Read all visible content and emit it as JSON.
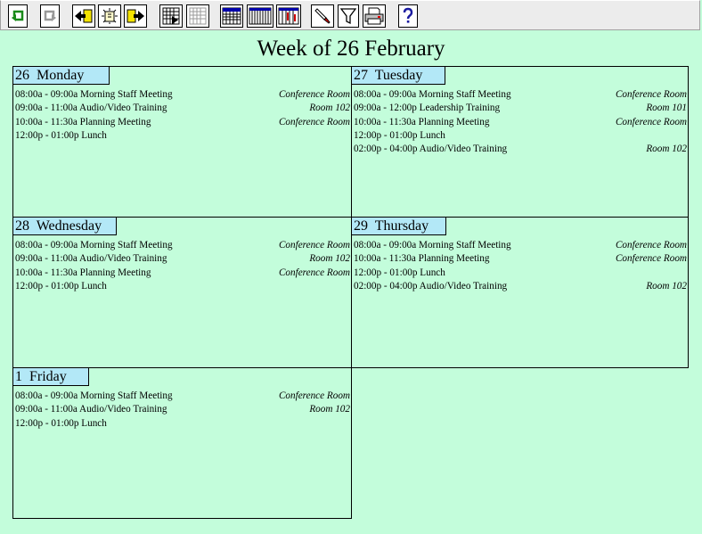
{
  "toolbar": {
    "buttons": [
      {
        "name": "undo-button",
        "icon": "undo-arrow-icon"
      },
      {
        "name": "redo-button",
        "icon": "redo-arrow-icon"
      },
      {
        "name": "previous-button",
        "icon": "arrow-left-icon"
      },
      {
        "name": "today-button",
        "icon": "sun-icon"
      },
      {
        "name": "next-button",
        "icon": "arrow-right-icon"
      },
      {
        "name": "play-button",
        "icon": "grid-play-icon"
      },
      {
        "name": "blank-grid-button",
        "icon": "grid-icon"
      },
      {
        "name": "week-view-button",
        "icon": "calendar-grid-icon"
      },
      {
        "name": "columns-view-button",
        "icon": "columns-icon"
      },
      {
        "name": "timeline-view-button",
        "icon": "timeline-icon"
      },
      {
        "name": "highlight-button",
        "icon": "highlighter-icon"
      },
      {
        "name": "filter-button",
        "icon": "funnel-icon"
      },
      {
        "name": "print-button",
        "icon": "printer-icon"
      },
      {
        "name": "help-button",
        "icon": "question-mark-icon"
      }
    ]
  },
  "title": "Week of 26 February",
  "days": [
    {
      "label": "26  Monday",
      "events": [
        {
          "time": "08:00a - 09:00a",
          "name": "Morning Staff Meeting",
          "location": "Conference Room"
        },
        {
          "time": "09:00a - 11:00a",
          "name": "Audio/Video Training",
          "location": "Room 102"
        },
        {
          "time": "10:00a - 11:30a",
          "name": "Planning Meeting",
          "location": "Conference Room"
        },
        {
          "time": "12:00p - 01:00p",
          "name": "Lunch",
          "location": ""
        }
      ]
    },
    {
      "label": "27  Tuesday",
      "events": [
        {
          "time": "08:00a - 09:00a",
          "name": "Morning Staff Meeting",
          "location": "Conference Room"
        },
        {
          "time": "09:00a - 12:00p",
          "name": "Leadership Training",
          "location": "Room 101"
        },
        {
          "time": "10:00a - 11:30a",
          "name": "Planning Meeting",
          "location": "Conference Room"
        },
        {
          "time": "12:00p - 01:00p",
          "name": "Lunch",
          "location": ""
        },
        {
          "time": "02:00p - 04:00p",
          "name": "Audio/Video Training",
          "location": "Room 102"
        }
      ]
    },
    {
      "label": "28  Wednesday",
      "events": [
        {
          "time": "08:00a - 09:00a",
          "name": "Morning Staff Meeting",
          "location": "Conference Room"
        },
        {
          "time": "09:00a - 11:00a",
          "name": "Audio/Video Training",
          "location": "Room 102"
        },
        {
          "time": "10:00a - 11:30a",
          "name": "Planning Meeting",
          "location": "Conference Room"
        },
        {
          "time": "12:00p - 01:00p",
          "name": "Lunch",
          "location": ""
        }
      ]
    },
    {
      "label": "29  Thursday",
      "events": [
        {
          "time": "08:00a - 09:00a",
          "name": "Morning Staff Meeting",
          "location": "Conference Room"
        },
        {
          "time": "10:00a - 11:30a",
          "name": "Planning Meeting",
          "location": "Conference Room"
        },
        {
          "time": "12:00p - 01:00p",
          "name": "Lunch",
          "location": ""
        },
        {
          "time": "02:00p - 04:00p",
          "name": "Audio/Video Training",
          "location": "Room 102"
        }
      ]
    },
    {
      "label": "1  Friday",
      "events": [
        {
          "time": "08:00a - 09:00a",
          "name": "Morning Staff Meeting",
          "location": "Conference Room"
        },
        {
          "time": "09:00a - 11:00a",
          "name": "Audio/Video Training",
          "location": "Room 102"
        },
        {
          "time": "12:00p - 01:00p",
          "name": "Lunch",
          "location": ""
        }
      ]
    }
  ]
}
